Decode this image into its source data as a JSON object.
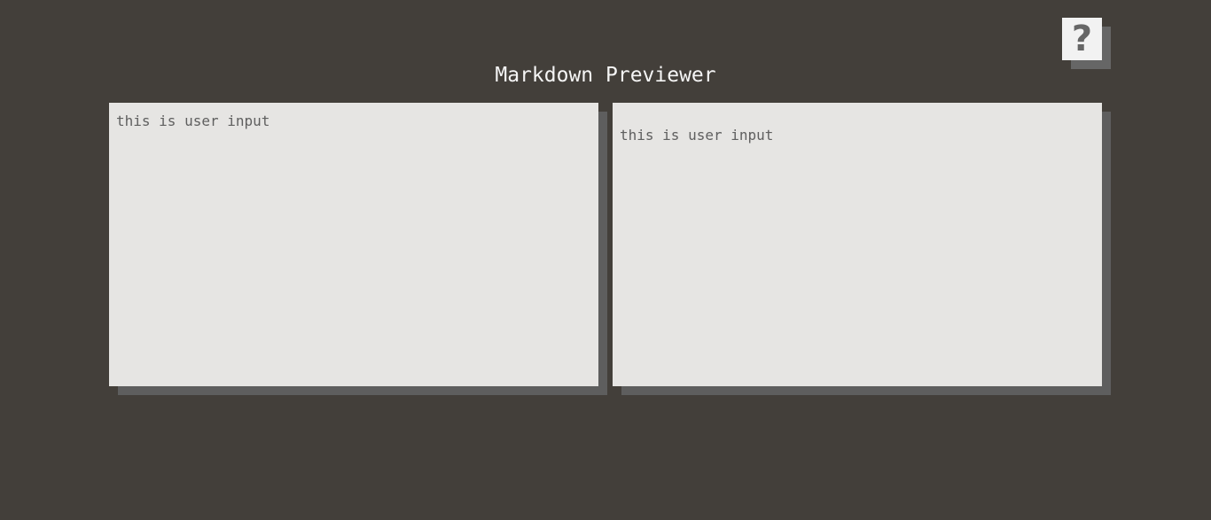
{
  "header": {
    "title": "Markdown Previewer",
    "help_icon": "question-mark-icon",
    "help_glyph": "?"
  },
  "editor": {
    "value": "this is user input"
  },
  "preview": {
    "paragraph": "this is user input"
  },
  "colors": {
    "background": "#433f3a",
    "pane": "#e6e5e3",
    "pane_shadow": "#5e5e5e",
    "text": "#5f5f5f",
    "title": "#f5f5f5"
  }
}
